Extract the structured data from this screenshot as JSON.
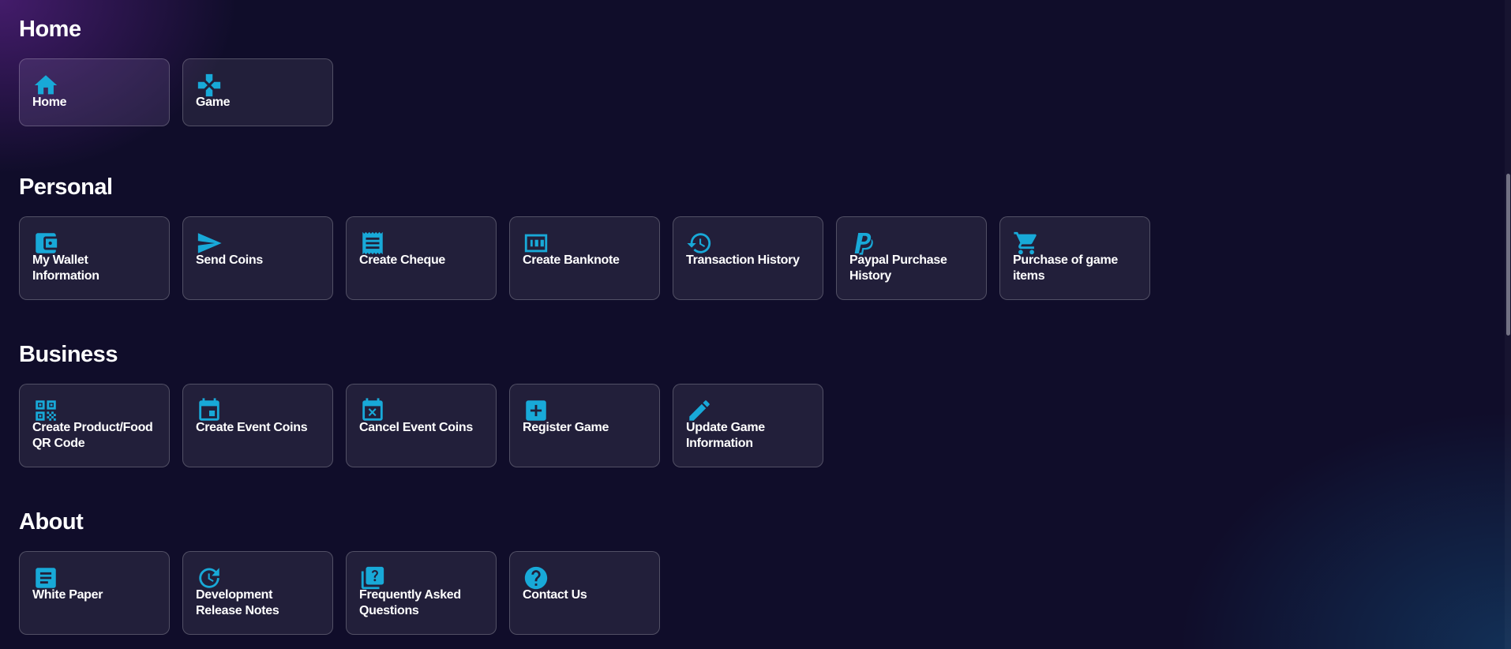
{
  "sections": [
    {
      "title": "Home",
      "items": [
        {
          "label": "Home",
          "icon": "home-icon"
        },
        {
          "label": "Game",
          "icon": "gamepad-icon"
        }
      ]
    },
    {
      "title": "Personal",
      "items": [
        {
          "label": "My Wallet Information",
          "icon": "wallet-icon"
        },
        {
          "label": "Send Coins",
          "icon": "send-icon"
        },
        {
          "label": "Create Cheque",
          "icon": "receipt-icon"
        },
        {
          "label": "Create Banknote",
          "icon": "banknote-icon"
        },
        {
          "label": "Transaction History",
          "icon": "history-icon"
        },
        {
          "label": "Paypal Purchase History",
          "icon": "paypal-icon"
        },
        {
          "label": "Purchase of game items",
          "icon": "cart-icon"
        }
      ]
    },
    {
      "title": "Business",
      "items": [
        {
          "label": "Create Product/Food QR Code",
          "icon": "qr-code-icon"
        },
        {
          "label": "Create Event Coins",
          "icon": "calendar-icon"
        },
        {
          "label": "Cancel Event Coins",
          "icon": "calendar-cancel-icon"
        },
        {
          "label": "Register Game",
          "icon": "plus-box-icon"
        },
        {
          "label": "Update Game Information",
          "icon": "pencil-icon"
        }
      ]
    },
    {
      "title": "About",
      "items": [
        {
          "label": "White Paper",
          "icon": "document-icon"
        },
        {
          "label": "Development Release Notes",
          "icon": "update-icon"
        },
        {
          "label": "Frequently Asked Questions",
          "icon": "faq-icon"
        },
        {
          "label": "Contact Us",
          "icon": "help-circle-icon"
        }
      ]
    }
  ],
  "colors": {
    "background": "#100d2a",
    "icon_accent": "#18a9d8",
    "card_border": "rgba(255,255,255,0.22)"
  }
}
